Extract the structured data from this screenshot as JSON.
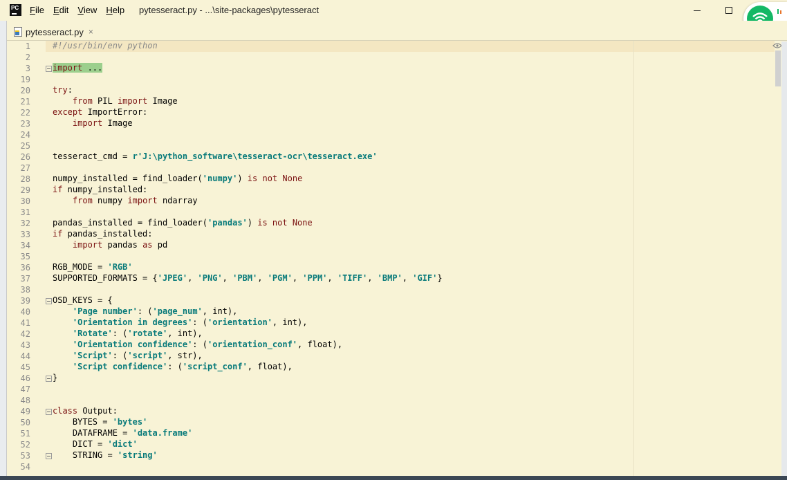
{
  "menu": {
    "file": "File",
    "edit": "Edit",
    "view": "View",
    "help": "Help"
  },
  "window": {
    "title": "pytesseract.py - ...\\site-packages\\pytesseract",
    "minimize": "",
    "maximize": ""
  },
  "app": {
    "logo_text": "PC"
  },
  "tab": {
    "label": "pytesseract.py",
    "close": "×"
  },
  "colors": {
    "keyword": "#000080",
    "string": "#087a7a",
    "comment": "#8a8a8a",
    "editor_bg": "#f8f3d6",
    "wifi": "#14b866"
  },
  "lines": [
    {
      "n": "1",
      "t": "#!/usr/bin/env python"
    },
    {
      "n": "2",
      "t": ""
    },
    {
      "n": "3",
      "t": "import ..."
    },
    {
      "n": "19",
      "t": ""
    },
    {
      "n": "20",
      "t": "try:"
    },
    {
      "n": "21",
      "t": "    from PIL import Image"
    },
    {
      "n": "22",
      "t": "except ImportError:"
    },
    {
      "n": "23",
      "t": "    import Image"
    },
    {
      "n": "24",
      "t": ""
    },
    {
      "n": "25",
      "t": ""
    },
    {
      "n": "26",
      "t": "tesseract_cmd = r'J:\\python_software\\tesseract-ocr\\tesseract.exe'"
    },
    {
      "n": "27",
      "t": ""
    },
    {
      "n": "28",
      "t": "numpy_installed = find_loader('numpy') is not None"
    },
    {
      "n": "29",
      "t": "if numpy_installed:"
    },
    {
      "n": "30",
      "t": "    from numpy import ndarray"
    },
    {
      "n": "31",
      "t": ""
    },
    {
      "n": "32",
      "t": "pandas_installed = find_loader('pandas') is not None"
    },
    {
      "n": "33",
      "t": "if pandas_installed:"
    },
    {
      "n": "34",
      "t": "    import pandas as pd"
    },
    {
      "n": "35",
      "t": ""
    },
    {
      "n": "36",
      "t": "RGB_MODE = 'RGB'"
    },
    {
      "n": "37",
      "t": "SUPPORTED_FORMATS = {'JPEG', 'PNG', 'PBM', 'PGM', 'PPM', 'TIFF', 'BMP', 'GIF'}"
    },
    {
      "n": "38",
      "t": ""
    },
    {
      "n": "39",
      "t": "OSD_KEYS = {"
    },
    {
      "n": "40",
      "t": "    'Page number': ('page_num', int),"
    },
    {
      "n": "41",
      "t": "    'Orientation in degrees': ('orientation', int),"
    },
    {
      "n": "42",
      "t": "    'Rotate': ('rotate', int),"
    },
    {
      "n": "43",
      "t": "    'Orientation confidence': ('orientation_conf', float),"
    },
    {
      "n": "44",
      "t": "    'Script': ('script', str),"
    },
    {
      "n": "45",
      "t": "    'Script confidence': ('script_conf', float),"
    },
    {
      "n": "46",
      "t": "}"
    },
    {
      "n": "47",
      "t": ""
    },
    {
      "n": "48",
      "t": ""
    },
    {
      "n": "49",
      "t": "class Output:"
    },
    {
      "n": "50",
      "t": "    BYTES = 'bytes'"
    },
    {
      "n": "51",
      "t": "    DATAFRAME = 'data.frame'"
    },
    {
      "n": "52",
      "t": "    DICT = 'dict'"
    },
    {
      "n": "53",
      "t": "    STRING = 'string'"
    },
    {
      "n": "54",
      "t": ""
    }
  ]
}
